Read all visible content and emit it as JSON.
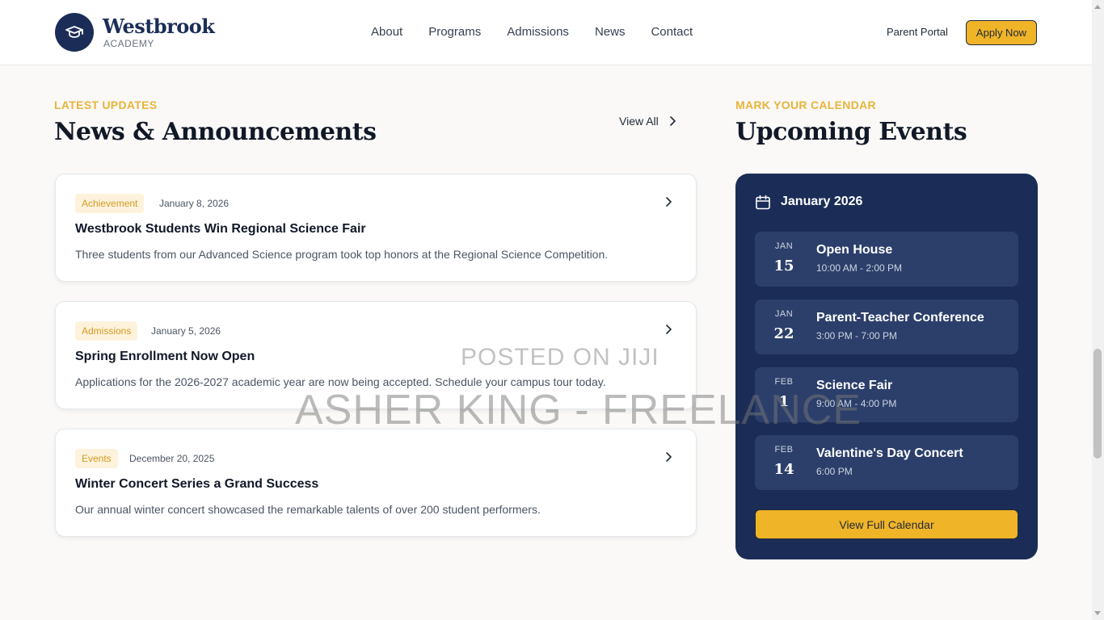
{
  "brand": {
    "name": "Westbrook",
    "sub": "ACADEMY"
  },
  "nav": [
    "About",
    "Programs",
    "Admissions",
    "News",
    "Contact"
  ],
  "header_actions": {
    "parent_portal": "Parent Portal",
    "apply": "Apply Now"
  },
  "news": {
    "eyebrow": "LATEST UPDATES",
    "title": "News & Announcements",
    "view_all": "View All",
    "items": [
      {
        "badge": "Achievement",
        "date": "January 8, 2026",
        "title": "Westbrook Students Win Regional Science Fair",
        "desc": "Three students from our Advanced Science program took top honors at the Regional Science Competition."
      },
      {
        "badge": "Admissions",
        "date": "January 5, 2026",
        "title": "Spring Enrollment Now Open",
        "desc": "Applications for the 2026-2027 academic year are now being accepted. Schedule your campus tour today."
      },
      {
        "badge": "Events",
        "date": "December 20, 2025",
        "title": "Winter Concert Series a Grand Success",
        "desc": "Our annual winter concert showcased the remarkable talents of over 200 student performers."
      }
    ]
  },
  "events": {
    "eyebrow": "MARK YOUR CALENDAR",
    "title": "Upcoming Events",
    "month": "January 2026",
    "items": [
      {
        "mon": "JAN",
        "day": "15",
        "name": "Open House",
        "time": "10:00 AM - 2:00 PM"
      },
      {
        "mon": "JAN",
        "day": "22",
        "name": "Parent-Teacher Conference",
        "time": "3:00 PM - 7:00 PM"
      },
      {
        "mon": "FEB",
        "day": "1",
        "name": "Science Fair",
        "time": "9:00 AM - 4:00 PM"
      },
      {
        "mon": "FEB",
        "day": "14",
        "name": "Valentine's Day Concert",
        "time": "6:00 PM"
      }
    ],
    "button": "View Full Calendar"
  },
  "watermark": {
    "line1": "POSTED ON JIJI",
    "line2": "ASHER KING - FREELANCE"
  },
  "colors": {
    "navy": "#1b2d57",
    "gold": "#f0b429",
    "eyebrow": "#e8b43a"
  }
}
